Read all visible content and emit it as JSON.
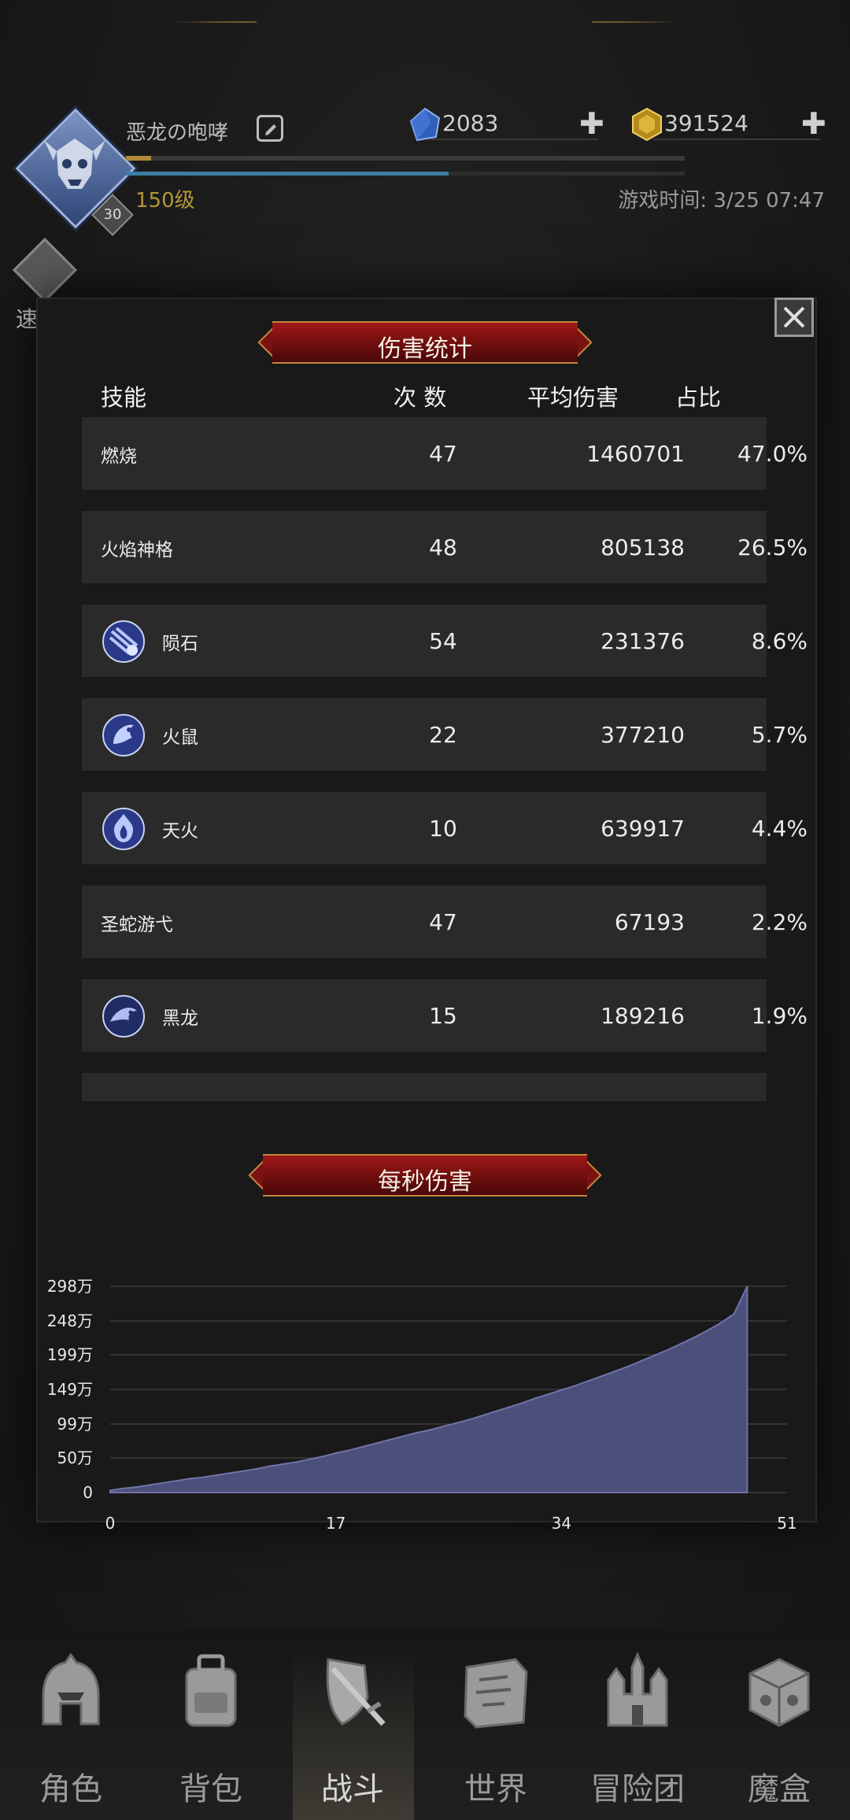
{
  "header": {
    "player_name": "恶龙の咆哮",
    "avatar_level_badge": "30",
    "level_label": "150级",
    "game_time": "游戏时间: 3/25 07:47",
    "quick_battle_label": "速战",
    "resources": [
      {
        "name": "gem",
        "value": "2083"
      },
      {
        "name": "gold",
        "value": "391524"
      }
    ]
  },
  "stats": {
    "title": "伤害统计",
    "columns": {
      "skill": "技能",
      "count": "次 数",
      "avg": "平均伤害",
      "share": "占比"
    },
    "rows": [
      {
        "skill": "燃烧",
        "count": "47",
        "avg": "1460701",
        "share": "47.0%",
        "icon": ""
      },
      {
        "skill": "火焰神格",
        "count": "48",
        "avg": "805138",
        "share": "26.5%",
        "icon": ""
      },
      {
        "skill": "陨石",
        "count": "54",
        "avg": "231376",
        "share": "8.6%",
        "icon": "meteor-icon"
      },
      {
        "skill": "火鼠",
        "count": "22",
        "avg": "377210",
        "share": "5.7%",
        "icon": "fire-rat-icon"
      },
      {
        "skill": "天火",
        "count": "10",
        "avg": "639917",
        "share": "4.4%",
        "icon": "sky-fire-icon"
      },
      {
        "skill": "圣蛇游弋",
        "count": "47",
        "avg": "67193",
        "share": "2.2%",
        "icon": ""
      },
      {
        "skill": "黑龙",
        "count": "15",
        "avg": "189216",
        "share": "1.9%",
        "icon": "black-dragon-icon"
      }
    ]
  },
  "dps": {
    "title": "每秒伤害"
  },
  "chart_data": {
    "type": "area",
    "title": "每秒伤害",
    "xlabel": "",
    "ylabel": "",
    "xlim": [
      0,
      51
    ],
    "ylim": [
      0,
      298
    ],
    "xticks": [
      "0",
      "17",
      "34",
      "51"
    ],
    "yticks": [
      "0",
      "50万",
      "99万",
      "149万",
      "199万",
      "248万",
      "298万"
    ],
    "ytick_values": [
      0,
      50,
      99,
      149,
      199,
      248,
      298
    ],
    "grid": true,
    "color": "#4c4f7a",
    "x": [
      0,
      1,
      2,
      3,
      4,
      5,
      6,
      7,
      8,
      9,
      10,
      11,
      12,
      13,
      14,
      15,
      16,
      17,
      18,
      19,
      20,
      21,
      22,
      23,
      24,
      25,
      26,
      27,
      28,
      29,
      30,
      31,
      32,
      33,
      34,
      35,
      36,
      37,
      38,
      39,
      40,
      41,
      42,
      43,
      44,
      45,
      46,
      47,
      48
    ],
    "values": [
      3,
      6,
      8,
      11,
      14,
      17,
      20,
      22,
      25,
      28,
      31,
      34,
      38,
      41,
      44,
      48,
      52,
      57,
      61,
      66,
      71,
      76,
      81,
      86,
      90,
      95,
      100,
      105,
      111,
      117,
      123,
      129,
      136,
      142,
      148,
      154,
      161,
      168,
      175,
      182,
      190,
      198,
      206,
      215,
      224,
      234,
      245,
      258,
      298
    ]
  },
  "nav": {
    "items": [
      {
        "label": "角色",
        "icon": "helmet-icon"
      },
      {
        "label": "背包",
        "icon": "backpack-icon"
      },
      {
        "label": "战斗",
        "icon": "sword-shield-icon"
      },
      {
        "label": "世界",
        "icon": "map-scroll-icon"
      },
      {
        "label": "冒险团",
        "icon": "castle-icon"
      },
      {
        "label": "魔盒",
        "icon": "magic-box-icon"
      }
    ],
    "active_index": 2
  }
}
